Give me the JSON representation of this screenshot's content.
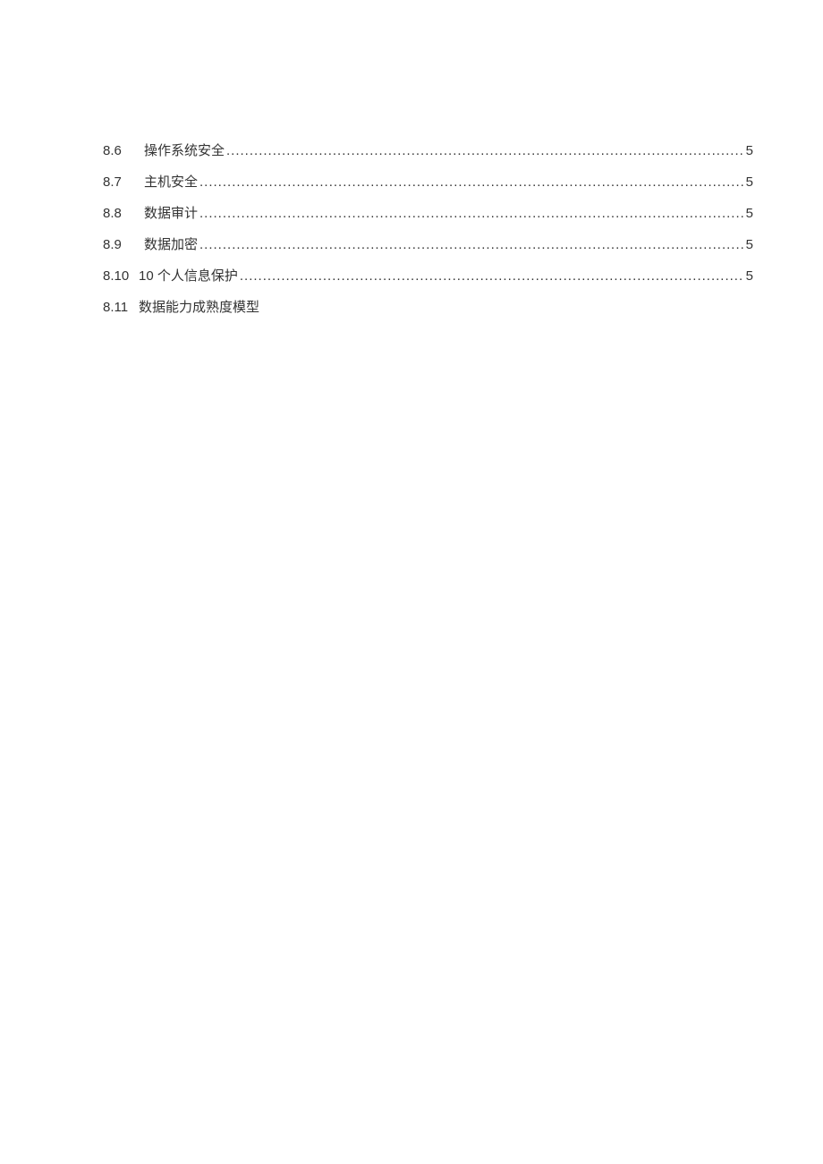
{
  "toc": {
    "entries": [
      {
        "num": "8.6",
        "title": "操作系统安全",
        "page": "5",
        "hasDots": true,
        "wide": false
      },
      {
        "num": "8.7",
        "title": "主机安全",
        "page": "5",
        "hasDots": true,
        "wide": false
      },
      {
        "num": "8.8",
        "title": "数据审计",
        "page": "5",
        "hasDots": true,
        "wide": false
      },
      {
        "num": "8.9",
        "title": "数据加密",
        "page": "5",
        "hasDots": true,
        "wide": false
      },
      {
        "num": "8.10",
        "title": "10 个人信息保护",
        "page": "5",
        "hasDots": true,
        "wide": true
      },
      {
        "num": "8.11",
        "title": "数据能力成熟度模型",
        "page": "",
        "hasDots": false,
        "wide": true
      }
    ]
  }
}
